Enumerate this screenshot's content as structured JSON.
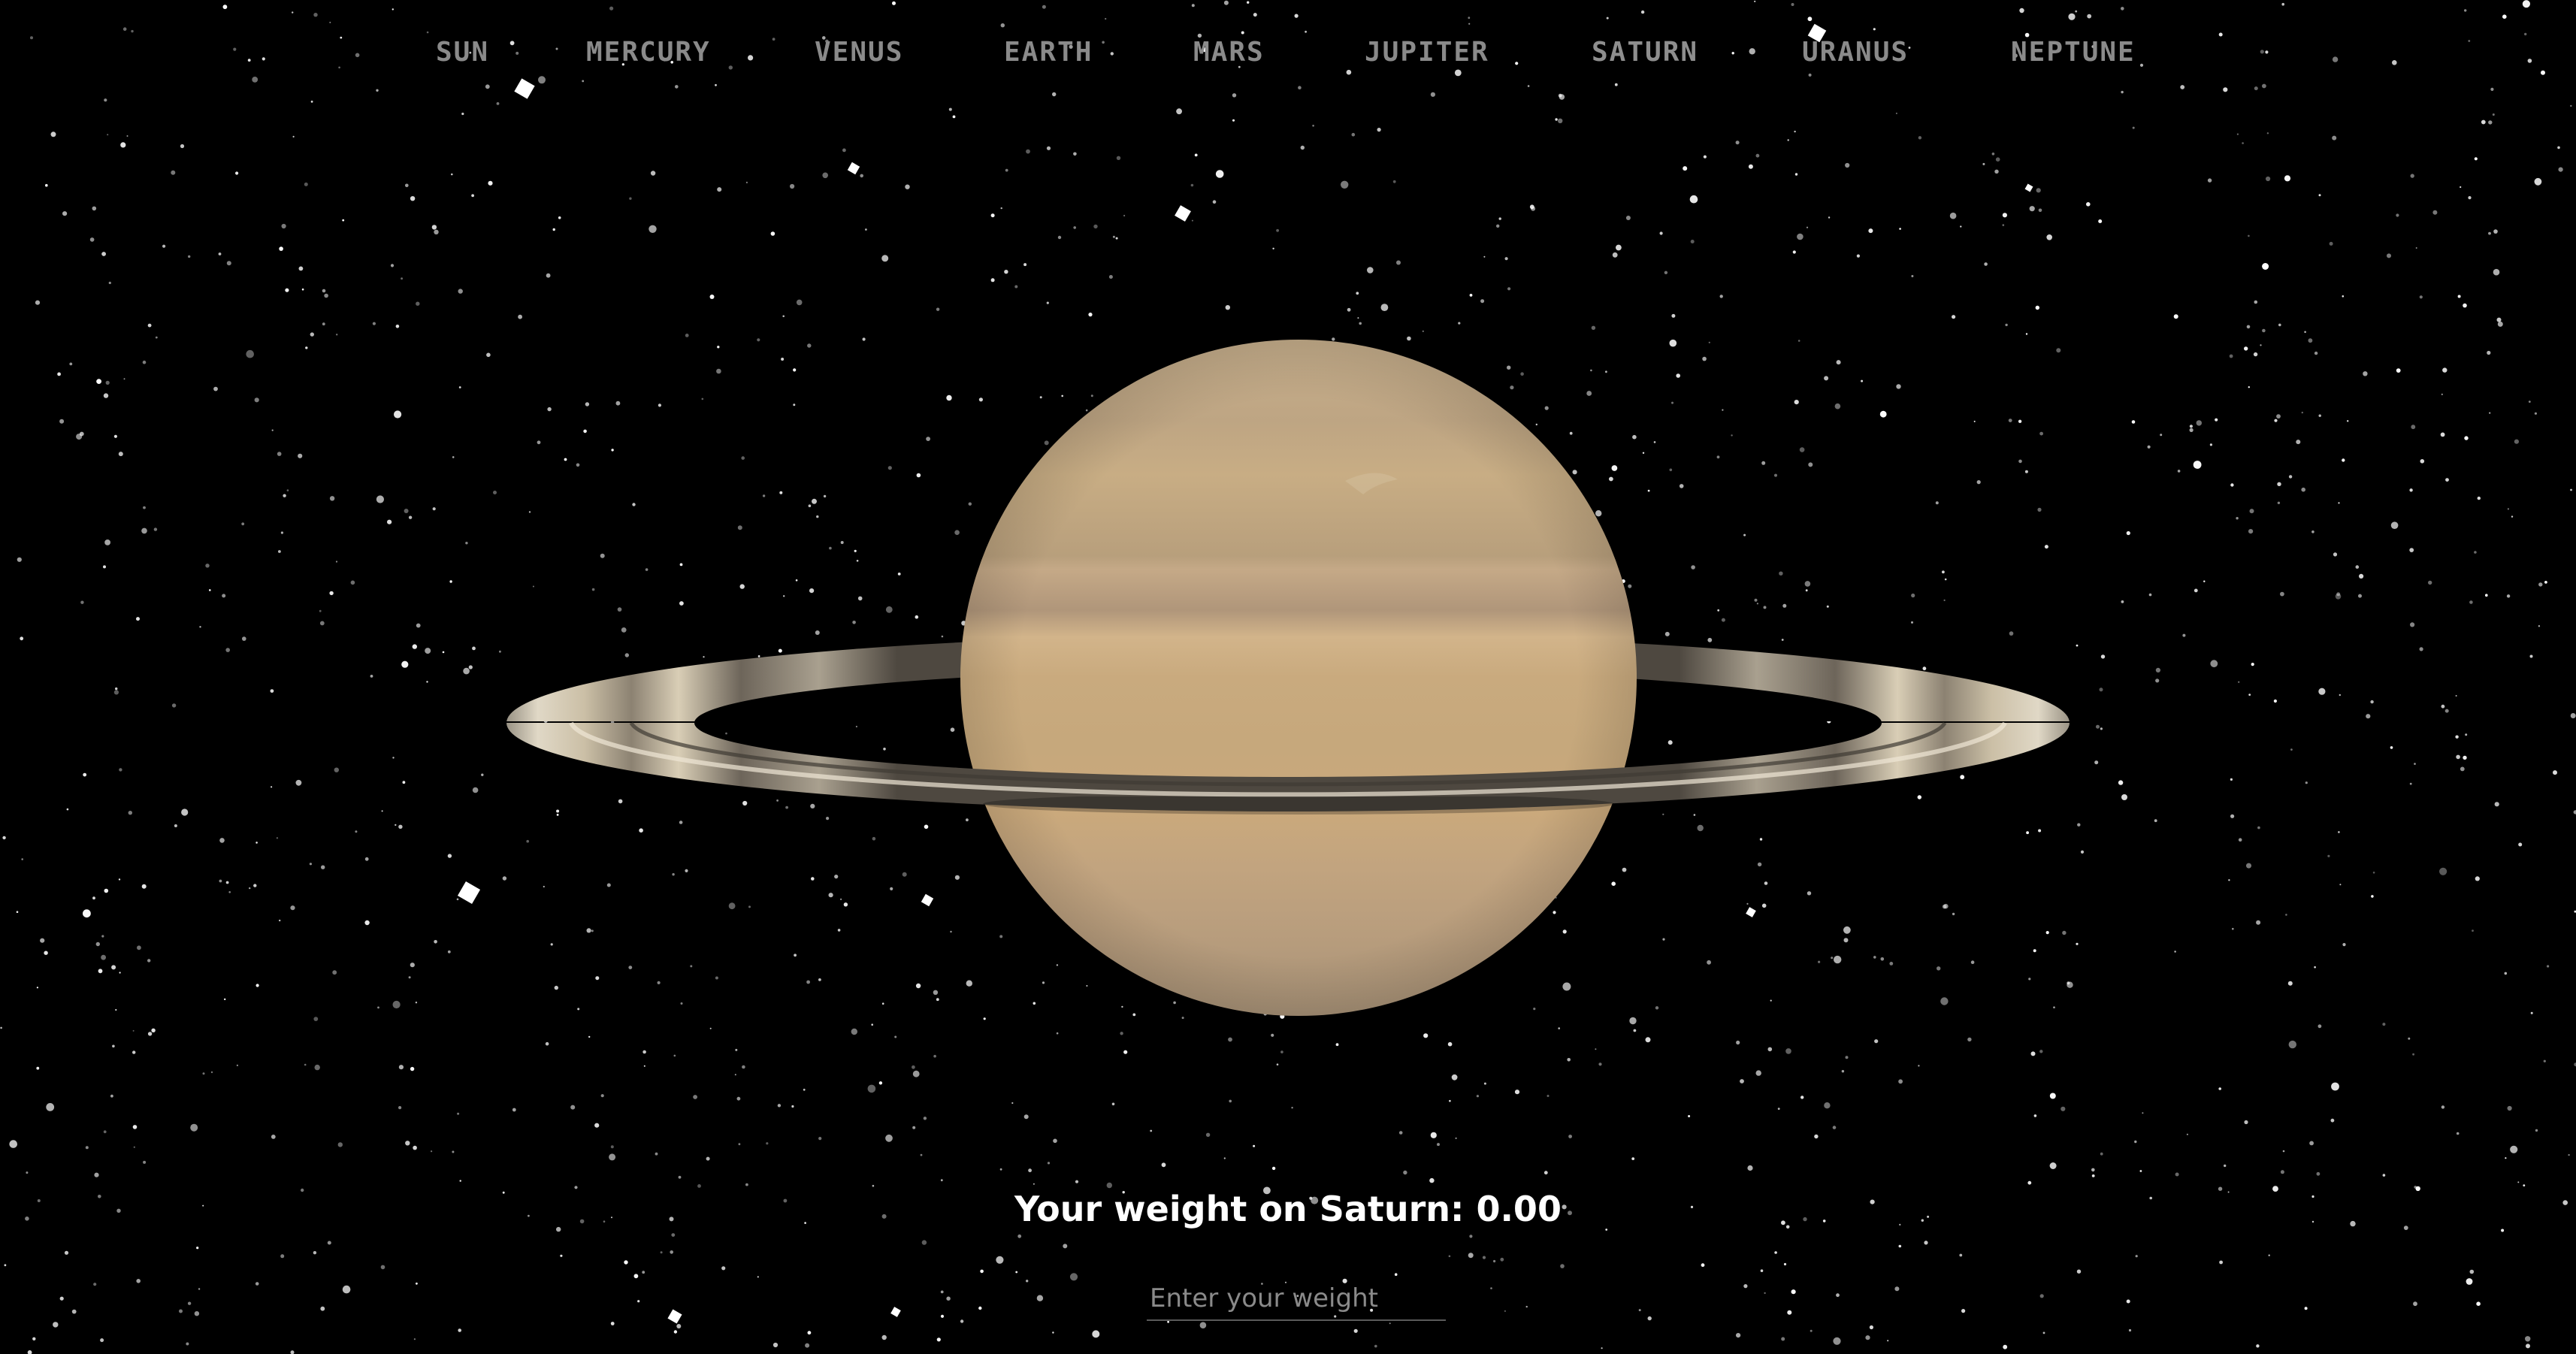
{
  "nav": {
    "items": [
      {
        "label": "SUN"
      },
      {
        "label": "MERCURY"
      },
      {
        "label": "VENUS"
      },
      {
        "label": "EARTH"
      },
      {
        "label": "MARS"
      },
      {
        "label": "JUPITER"
      },
      {
        "label": "SATURN"
      },
      {
        "label": "URANUS"
      },
      {
        "label": "NEPTUNE"
      }
    ],
    "active": "SATURN"
  },
  "planet": {
    "name": "Saturn",
    "icon": "saturn-planet-icon",
    "colors": {
      "body_light": "#c9ad82",
      "body_dark": "#a98c66",
      "ring_light": "#d8ccb0",
      "ring_dark": "#5e564a"
    }
  },
  "weight": {
    "prefix": "Your weight on Saturn:",
    "value": "0.00"
  },
  "input": {
    "placeholder": "Enter your weight"
  },
  "theme": {
    "background": "#000000",
    "nav_text": "#8a8a8a",
    "weight_text": "#ffffff"
  }
}
